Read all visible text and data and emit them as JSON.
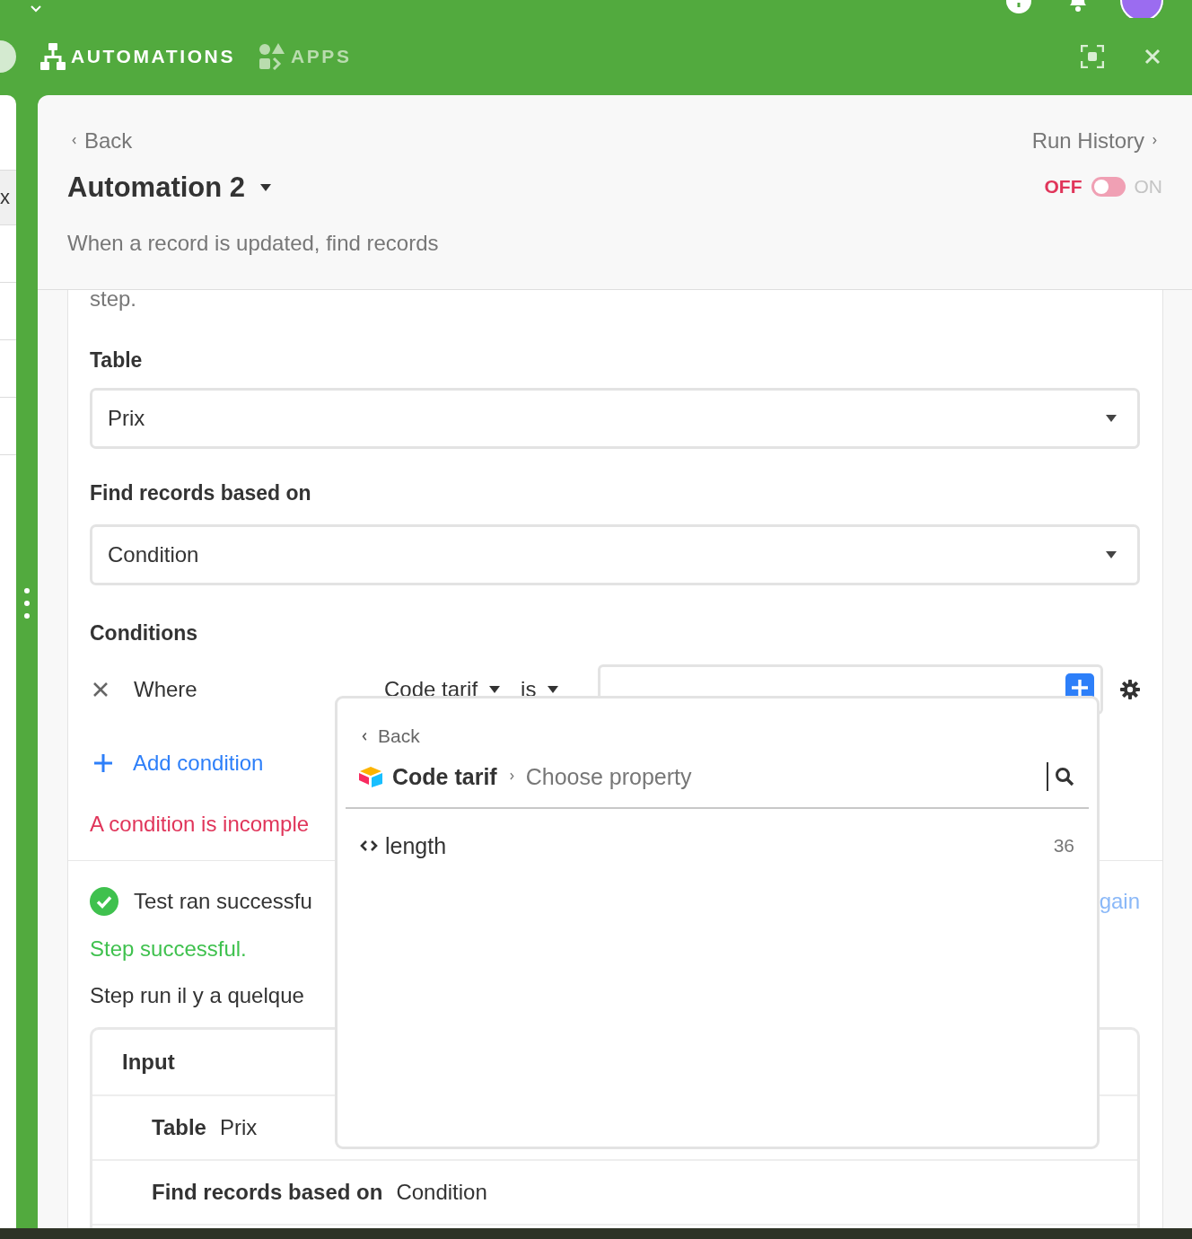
{
  "tabs": [
    {
      "label": "AUTOMATIONS",
      "kind": "automations",
      "selected": true
    },
    {
      "label": "APPS",
      "kind": "apps",
      "selected": false
    }
  ],
  "background_grid": {
    "cell": "x"
  },
  "header": {
    "back": "Back",
    "run_history": "Run History",
    "title": "Automation 2",
    "description": "When a record is updated, find records",
    "toggle": {
      "off_label": "OFF",
      "on_label": "ON",
      "on": false
    }
  },
  "step": {
    "intro_tail": "step.",
    "fields": [
      {
        "label": "Table",
        "value": "Prix"
      },
      {
        "label": "Find records based on",
        "value": "Condition"
      }
    ],
    "conditions": {
      "label": "Conditions",
      "rows": [
        {
          "prefix": "Where",
          "field": "Code tarif",
          "operator": "is"
        }
      ],
      "add": "Add condition",
      "error": "A condition is incomple"
    },
    "test": {
      "status": "Test ran successfu",
      "retry": "gain",
      "result": "Step successful.",
      "time": "Step run il y a quelque",
      "input": {
        "title": "Input",
        "rows": [
          {
            "key": "Table",
            "value": "Prix"
          },
          {
            "key": "Find records based on",
            "value": "Condition"
          }
        ]
      }
    }
  },
  "popup": {
    "back": "Back",
    "table": "Code tarif",
    "prompt": "Choose property",
    "items": [
      {
        "name": "length",
        "count": "36"
      }
    ]
  }
}
